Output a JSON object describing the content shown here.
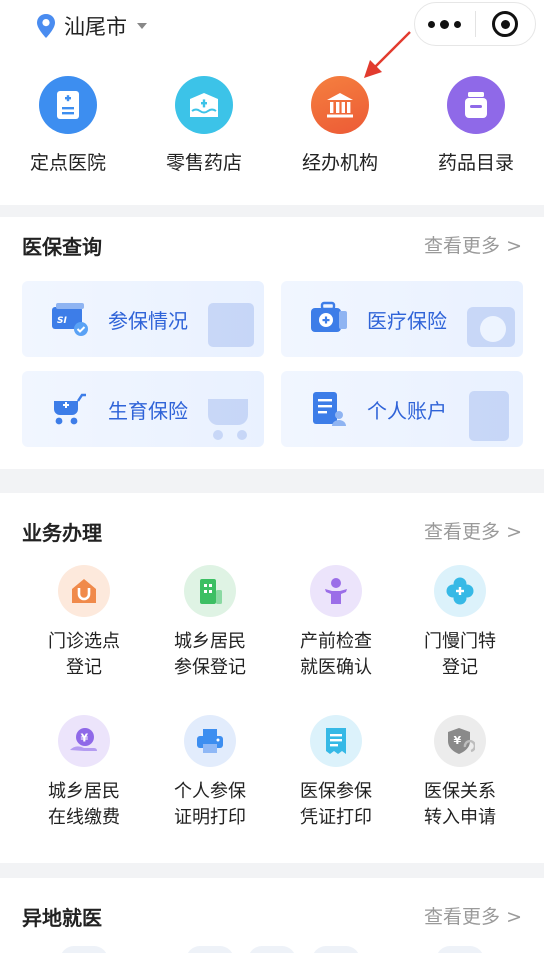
{
  "header": {
    "city": "汕尾市",
    "icons": {
      "location": "location-pin-icon",
      "more": "more-dots-icon",
      "close": "target-close-icon"
    },
    "accent": "#4a8cf0"
  },
  "topnav": {
    "items": [
      {
        "label": "定点医院",
        "icon": "hospital-icon",
        "color": "#3d8ef0"
      },
      {
        "label": "零售药店",
        "icon": "pharmacy-icon",
        "color": "#3cc3e8"
      },
      {
        "label": "经办机构",
        "icon": "institution-icon",
        "color": "#f06b3a"
      },
      {
        "label": "药品目录",
        "icon": "medicine-jar-icon",
        "color": "#8f69e8"
      }
    ]
  },
  "insurance_query": {
    "title": "医保查询",
    "more": "查看更多 >",
    "tiles": [
      {
        "label": "参保情况",
        "icon": "insurance-card-icon"
      },
      {
        "label": "医疗保险",
        "icon": "medical-kit-icon"
      },
      {
        "label": "生育保险",
        "icon": "stroller-icon"
      },
      {
        "label": "个人账户",
        "icon": "account-doc-icon"
      }
    ]
  },
  "business": {
    "title": "业务办理",
    "more": "查看更多 >",
    "items": [
      {
        "l1": "门诊选点",
        "l2": "登记",
        "icon": "clinic-house-icon",
        "color": "#f08a4b"
      },
      {
        "l1": "城乡居民",
        "l2": "参保登记",
        "icon": "building-icon",
        "color": "#3cbf63"
      },
      {
        "l1": "产前检查",
        "l2": "就医确认",
        "icon": "child-icon",
        "color": "#9b6ee8"
      },
      {
        "l1": "门慢门特",
        "l2": "登记",
        "icon": "clover-cross-icon",
        "color": "#36b9e6"
      },
      {
        "l1": "城乡居民",
        "l2": "在线缴费",
        "icon": "yuan-hand-icon",
        "color": "#8f69e8"
      },
      {
        "l1": "个人参保",
        "l2": "证明打印",
        "icon": "printer-icon",
        "color": "#3d8ef0"
      },
      {
        "l1": "医保参保",
        "l2": "凭证打印",
        "icon": "receipt-icon",
        "color": "#36b9e6"
      },
      {
        "l1": "医保关系",
        "l2": "转入申请",
        "icon": "yuan-shield-icon",
        "color": "#8a8a8a"
      }
    ]
  },
  "remote_care": {
    "title": "异地就医",
    "more": "查看更多 >"
  }
}
